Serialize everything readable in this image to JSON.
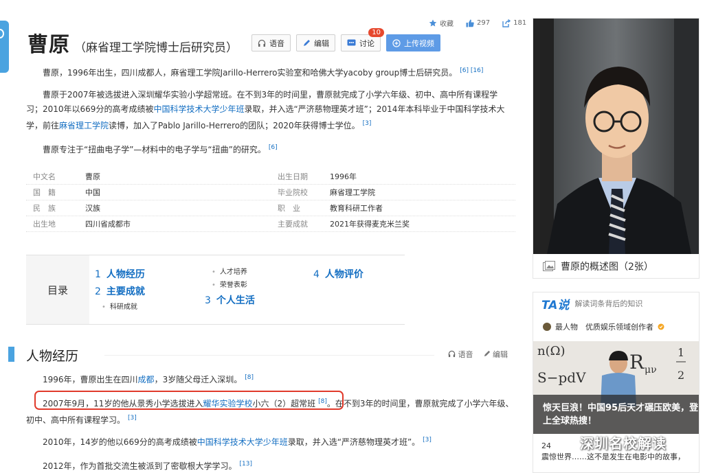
{
  "actions": {
    "favorite": "收藏",
    "likes": "297",
    "shares": "181"
  },
  "title": {
    "name": "曹原",
    "subtitle": "（麻省理工学院博士后研究员）"
  },
  "buttons": {
    "voice": "语音",
    "edit": "编辑",
    "discuss": "讨论",
    "discuss_count": "10",
    "upload": "上传视频"
  },
  "intro": {
    "p1": "曹原，1996年出生，四川成都人，麻省理工学院Jarillo-Herrero实验室和哈佛大学yacoby group博士后研究员。",
    "p1_refs": "[6] [16]",
    "p2a": "曹原于2007年被选拔进入深圳耀华实验小学超常班。在不到3年的时间里，曹原就完成了小学六年级、初中、高中所有课程学习；2010年以669分的高考成绩被",
    "p2_link1": "中国科学技术大学少年班",
    "p2b": "录取，并入选“严济慈物理英才班”；2014年本科毕业于中国科学技术大学，前往",
    "p2_link2": "麻省理工学院",
    "p2c": "读博，加入了Pablo Jarillo-Herrero的团队；2020年获得博士学位。",
    "p2_ref": "[3]",
    "p3": "曹原专注于“扭曲电子学”—材料中的电子学与“扭曲”的研究。",
    "p3_ref": "[6]"
  },
  "info": [
    {
      "k": "中文名",
      "v": "曹原",
      "k2": "出生日期",
      "v2": "1996年"
    },
    {
      "k": "国　籍",
      "v": "中国",
      "k2": "毕业院校",
      "v2": "麻省理工学院"
    },
    {
      "k": "民　族",
      "v": "汉族",
      "k2": "职　业",
      "v2": "教育科研工作者"
    },
    {
      "k": "出生地",
      "v": "四川省成都市",
      "k2": "主要成就",
      "v2": "2021年获得麦克米兰奖"
    }
  ],
  "toc": {
    "label": "目录",
    "h1": {
      "n": "1",
      "t": "人物经历"
    },
    "h2": {
      "n": "2",
      "t": "主要成就"
    },
    "s_research": "科研成就",
    "s_talent": "人才培养",
    "s_honor": "荣誉表彰",
    "h3": {
      "n": "3",
      "t": "个人生活"
    },
    "h4": {
      "n": "4",
      "t": "人物评价"
    }
  },
  "section": {
    "title": "人物经历",
    "voice": "语音",
    "edit": "编辑"
  },
  "history": {
    "l1a": "1996年，曹原出生在四川",
    "l1_link": "成都",
    "l1b": "，3岁随父母迁入深圳。",
    "l1_ref": "[8]",
    "l2a": "2007年9月，11岁的他从景秀小学选拔进入",
    "l2_link": "耀华实验学校",
    "l2b": "小六（2）超常班",
    "l2_ref": "[8]",
    "l2c": "。在不到3年的时间里，曹原就完成了小学六年级、初中、高中所有课程学习。",
    "l2_ref2": "[3]",
    "l3a": "2010年，14岁的他以669分的高考成绩被",
    "l3_link": "中国科学技术大学少年班",
    "l3b": "录取，并入选“严济慈物理英才班”。",
    "l3_ref": "[3]",
    "l4": "2012年，作为首批交流生被派到了密歇根大学学习。",
    "l4_ref": "[13]"
  },
  "sidebar": {
    "caption": "曹原的概述图（2张）",
    "ta_logo": "TA说",
    "ta_hint": "解读词条背后的知识",
    "author": "最人物　优质娱乐领域创作者",
    "card_text": "惊天巨浪！中国95后天才碾压欧美，登上全球热搜！",
    "foot_line1": "24",
    "foot_line2": "震惊世界……这不是发生在电影中的故事，",
    "watermark": "深圳名校解读"
  }
}
